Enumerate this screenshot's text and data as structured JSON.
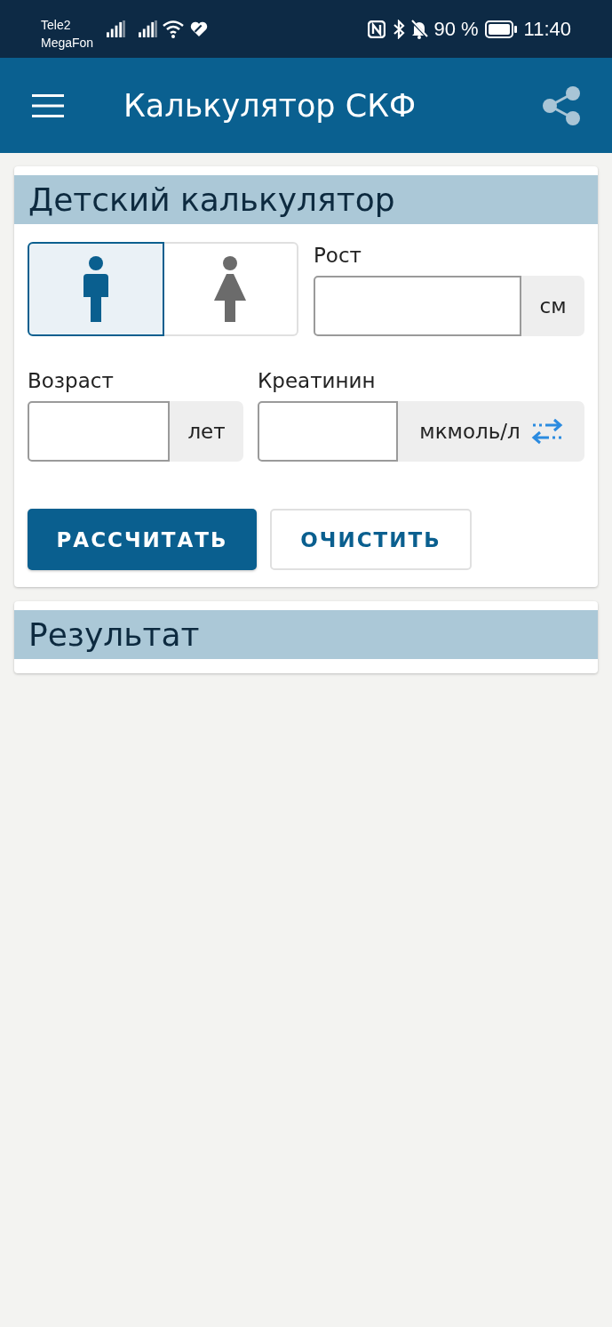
{
  "status_bar": {
    "carriers": [
      "Tele2",
      "MegaFon"
    ],
    "battery": "90 %",
    "time": "11:40"
  },
  "app_bar": {
    "title": "Калькулятор СКФ"
  },
  "calculator": {
    "title": "Детский калькулятор",
    "sex_options": [
      {
        "kind": "male",
        "selected": true
      },
      {
        "kind": "female",
        "selected": false
      }
    ],
    "height": {
      "label": "Рост",
      "unit": "см"
    },
    "age": {
      "label": "Возраст",
      "unit": "лет"
    },
    "creatinine": {
      "label": "Креатинин",
      "unit": "мкмоль/л"
    },
    "buttons": [
      {
        "label": "РАССЧИТАТЬ",
        "kind": "primary"
      },
      {
        "label": "ОЧИСТИТЬ",
        "kind": "secondary"
      }
    ]
  },
  "result": {
    "title": "Результат"
  }
}
